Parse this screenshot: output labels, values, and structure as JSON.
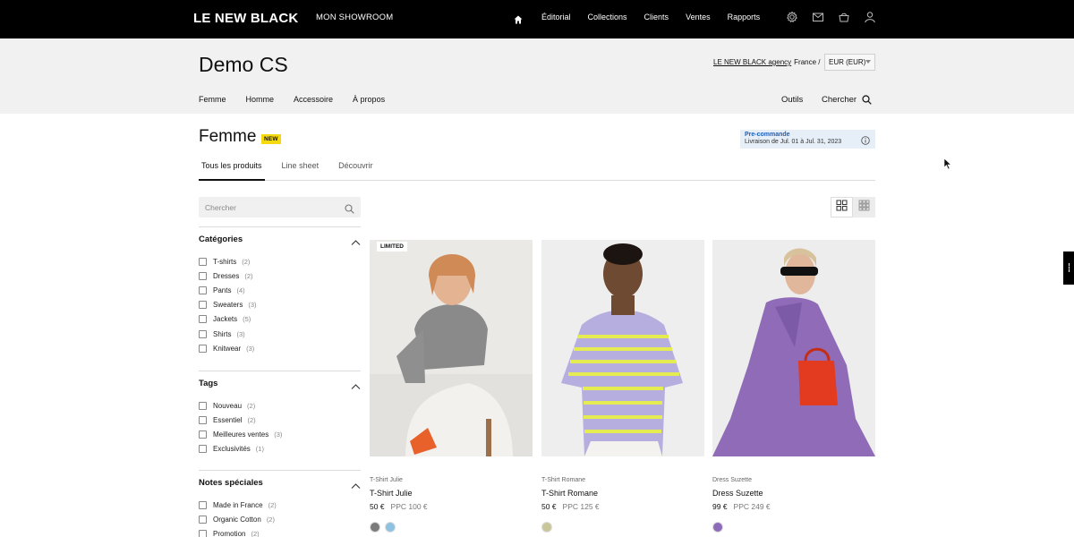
{
  "topbar": {
    "logo": "LE NEW BLACK",
    "showroom": "MON SHOWROOM",
    "nav": [
      "Éditorial",
      "Collections",
      "Clients",
      "Ventes",
      "Rapports"
    ]
  },
  "header": {
    "store_title": "Demo CS",
    "agency_link": "LE NEW BLACK agency",
    "country": "France /",
    "currency": "EUR (EUR)",
    "categories": [
      "Femme",
      "Homme",
      "Accessoire",
      "À propos"
    ],
    "tools": "Outils",
    "search": "Chercher"
  },
  "page": {
    "title": "Femme",
    "badge": "NEW",
    "preorder_title": "Pre-commande",
    "preorder_date": "Livraison de Jul. 01 à Jul. 31, 2023",
    "tabs": [
      "Tous les produits",
      "Line sheet",
      "Découvrir"
    ]
  },
  "sidebar": {
    "search_placeholder": "Chercher",
    "filters": [
      {
        "title": "Catégories",
        "items": [
          {
            "label": "T-shirts",
            "count": "(2)"
          },
          {
            "label": "Dresses",
            "count": "(2)"
          },
          {
            "label": "Pants",
            "count": "(4)"
          },
          {
            "label": "Sweaters",
            "count": "(3)"
          },
          {
            "label": "Jackets",
            "count": "(5)"
          },
          {
            "label": "Shirts",
            "count": "(3)"
          },
          {
            "label": "Knitwear",
            "count": "(3)"
          }
        ]
      },
      {
        "title": "Tags",
        "items": [
          {
            "label": "Nouveau",
            "count": "(2)"
          },
          {
            "label": "Essentiel",
            "count": "(2)"
          },
          {
            "label": "Meilleures ventes",
            "count": "(3)"
          },
          {
            "label": "Exclusivités",
            "count": "(1)"
          }
        ]
      },
      {
        "title": "Notes spéciales",
        "items": [
          {
            "label": "Made in France",
            "count": "(2)"
          },
          {
            "label": "Organic Cotton",
            "count": "(2)"
          },
          {
            "label": "Promotion",
            "count": "(2)"
          }
        ]
      }
    ]
  },
  "products": [
    {
      "badge": "LIMITED",
      "subtitle": "T-Shirt Julie",
      "name": "T-Shirt Julie",
      "price": "50 €",
      "ppc": "PPC 100 €",
      "swatches": [
        "#7b7b7b",
        "#8ec2e0"
      ]
    },
    {
      "badge": "",
      "subtitle": "T-Shirt Romane",
      "name": "T-Shirt Romane",
      "price": "50 €",
      "ppc": "PPC 125 €",
      "swatches": [
        "#c9c79a"
      ]
    },
    {
      "badge": "",
      "subtitle": "Dress Suzette",
      "name": "Dress Suzette",
      "price": "99 €",
      "ppc": "PPC 249 €",
      "swatches": [
        "#8d6bb8"
      ]
    }
  ],
  "colors": {
    "accent_blue": "#1f5fb8",
    "badge_yellow": "#f4d90e"
  }
}
